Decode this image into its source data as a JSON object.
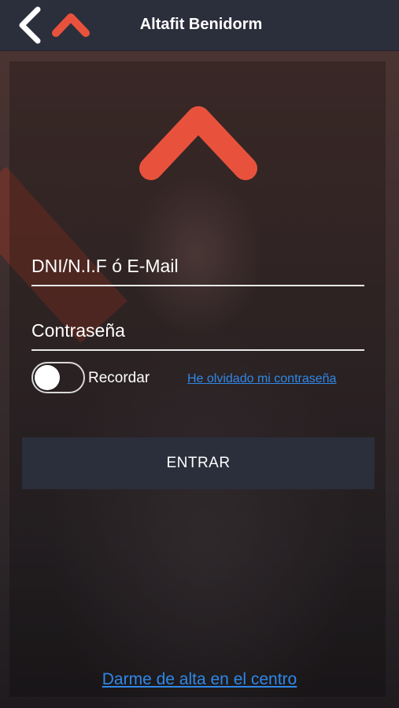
{
  "header": {
    "title": "Altafit Benidorm",
    "back_icon": "chevron-left-icon",
    "logo_icon": "altafit-logo-icon"
  },
  "form": {
    "user_placeholder": "DNI/N.I.F ó E-Mail",
    "user_value": "",
    "password_placeholder": "Contraseña",
    "password_value": "",
    "remember_label": "Recordar",
    "remember_on": false,
    "forgot_link": "He olvidado mi contraseña",
    "submit_label": "ENTRAR"
  },
  "footer": {
    "signup_link": "Darme de alta en el centro"
  },
  "colors": {
    "brand": "#e8523d",
    "header_bg": "#2b2e3b",
    "link": "#2f88e8"
  }
}
